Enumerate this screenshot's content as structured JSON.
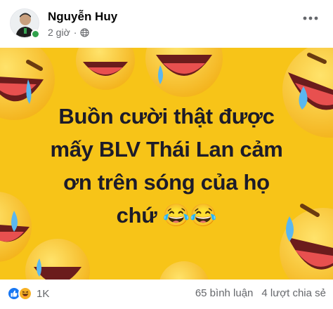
{
  "post": {
    "author_name": "Nguyễn Huy",
    "time": "2 giờ",
    "audience_icon": "globe-icon",
    "more_icon": "more-options-icon",
    "text_lines": [
      "Buồn cười thật được",
      "mấy BLV Thái Lan cảm",
      "ơn trên sóng của họ",
      "chứ 😂😂"
    ],
    "background_color": "#f7c418",
    "text_color": "#1c1b2a"
  },
  "footer": {
    "reaction_icons": [
      "like-icon",
      "haha-icon"
    ],
    "reaction_count": "1K",
    "comments": "65 bình luận",
    "shares": "4 lượt chia sẻ"
  }
}
